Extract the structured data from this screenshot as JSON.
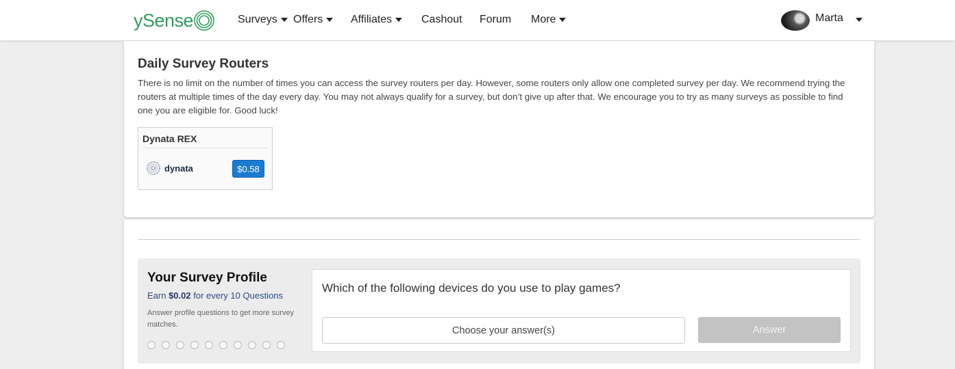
{
  "nav": {
    "logo_text": "ySense",
    "items": [
      {
        "label": "Surveys",
        "has_caret": true
      },
      {
        "label": "Offers",
        "has_caret": true
      },
      {
        "label": "Affiliates",
        "has_caret": true
      },
      {
        "label": "Cashout",
        "has_caret": false
      },
      {
        "label": "Forum",
        "has_caret": false
      },
      {
        "label": "More",
        "has_caret": true
      }
    ],
    "user_name": "Marta"
  },
  "routers": {
    "heading": "Daily Survey Routers",
    "description": "There is no limit on the number of times you can access the survey routers per day. However, some routers only allow one completed survey per day. We recommend trying the routers at multiple times of the day every day. You may not always qualify for a survey, but don’t give up after that. We encourage you to try as many surveys as possible to find one you are eligible for. Good luck!",
    "items": [
      {
        "title": "Dynata REX",
        "brand": "dynata",
        "price": "$0.58"
      }
    ]
  },
  "profile": {
    "title": "Your Survey Profile",
    "earn_prefix": "Earn ",
    "earn_amount": "$0.02",
    "earn_suffix": " for every 10 Questions",
    "hint": "Answer profile questions to get more survey matches.",
    "progress_total": 10,
    "progress_done": 0,
    "question": "Which of the following devices do you use to play games?",
    "select_placeholder": "Choose your answer(s)",
    "answer_label": "Answer"
  },
  "colors": {
    "brand_green": "#2f9c5c",
    "price_blue": "#1a7bd1",
    "answer_disabled": "#c3c3c3"
  }
}
